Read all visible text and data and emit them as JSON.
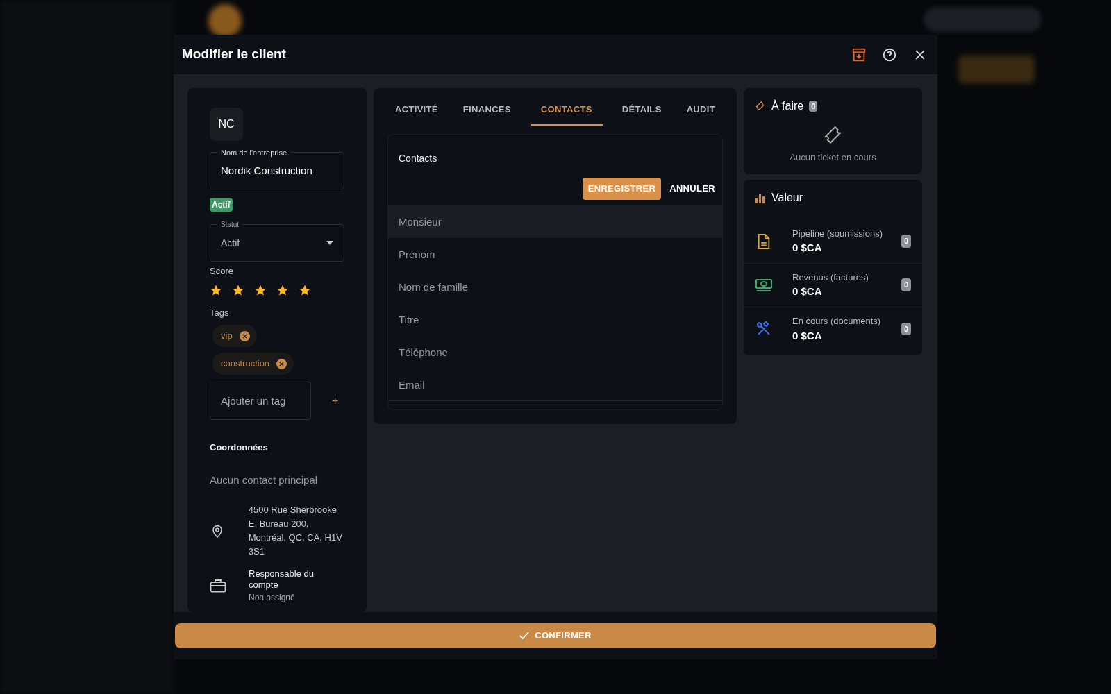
{
  "dialog": {
    "title": "Modifier le client"
  },
  "client": {
    "initials": "NC",
    "company_label": "Nom de l'entreprise",
    "company": "Nordik Construction",
    "status_badge": "Actif",
    "status_label": "Statut",
    "status": "Actif",
    "score_label": "Score",
    "stars": 5,
    "tags_label": "Tags",
    "tags": [
      "vip",
      "construction"
    ],
    "tag_placeholder": "Ajouter un tag",
    "add_symbol": "+",
    "coords_title": "Coordonnées",
    "no_contact": "Aucun contact principal",
    "address": "4500 Rue Sherbrooke E, Bureau 200, Montréal, QC, CA, H1V 3S1",
    "manager_label": "Responsable du compte",
    "manager": "Non assigné"
  },
  "tabs": [
    {
      "label": "ACTIVITÉ",
      "selected": false
    },
    {
      "label": "FINANCES",
      "selected": false
    },
    {
      "label": "CONTACTS",
      "selected": true
    },
    {
      "label": "DÉTAILS",
      "selected": false
    },
    {
      "label": "AUDIT",
      "selected": false
    }
  ],
  "contacts": {
    "title": "Contacts",
    "save": "ENREGISTRER",
    "cancel": "ANNULER",
    "fields": [
      {
        "placeholder": "Monsieur",
        "selected": true
      },
      {
        "placeholder": "Prénom",
        "selected": false
      },
      {
        "placeholder": "Nom de famille",
        "selected": false
      },
      {
        "placeholder": "Titre",
        "selected": false
      },
      {
        "placeholder": "Téléphone",
        "selected": false
      },
      {
        "placeholder": "Email",
        "selected": false
      }
    ]
  },
  "todo": {
    "title": "À faire",
    "count": "0",
    "empty": "Aucun ticket en cours"
  },
  "value": {
    "title": "Valeur",
    "items": [
      {
        "kind": "document",
        "label": "Pipeline (soumissions)",
        "amount": "0 $CA",
        "count": "0"
      },
      {
        "kind": "money",
        "label": "Revenus (factures)",
        "amount": "0 $CA",
        "count": "0"
      },
      {
        "kind": "tools",
        "label": "En cours (documents)",
        "amount": "0 $CA",
        "count": "0"
      }
    ]
  },
  "confirm": "CONFIRMER"
}
